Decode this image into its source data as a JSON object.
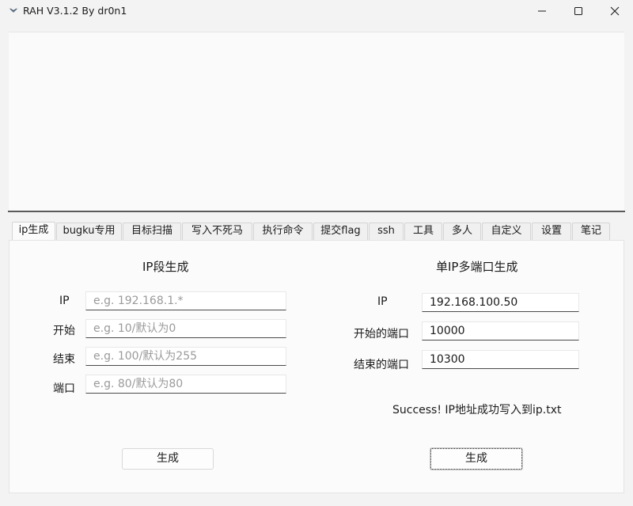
{
  "window": {
    "title": "RAH V3.1.2  By dr0n1"
  },
  "tabs": [
    {
      "label": "ip生成",
      "active": true
    },
    {
      "label": "bugku专用"
    },
    {
      "label": "目标扫描"
    },
    {
      "label": "写入不死马"
    },
    {
      "label": "执行命令"
    },
    {
      "label": "提交flag"
    },
    {
      "label": "ssh"
    },
    {
      "label": "工具"
    },
    {
      "label": "多人"
    },
    {
      "label": "自定义"
    },
    {
      "label": "设置"
    },
    {
      "label": "笔记"
    }
  ],
  "left_panel": {
    "title": "IP段生成",
    "ip_label": "IP",
    "ip_placeholder": "e.g. 192.168.1.*",
    "start_label": "开始",
    "start_placeholder": "e.g. 10/默认为0",
    "end_label": "结束",
    "end_placeholder": "e.g. 100/默认为255",
    "port_label": "端口",
    "port_placeholder": "e.g. 80/默认为80",
    "generate_label": "生成"
  },
  "right_panel": {
    "title": "单IP多端口生成",
    "ip_label": "IP",
    "ip_value": "192.168.100.50",
    "start_port_label": "开始的端口",
    "start_port_value": "10000",
    "end_port_label": "结束的端口",
    "end_port_value": "10300",
    "status": "Success! IP地址成功写入到ip.txt",
    "generate_label": "生成"
  }
}
